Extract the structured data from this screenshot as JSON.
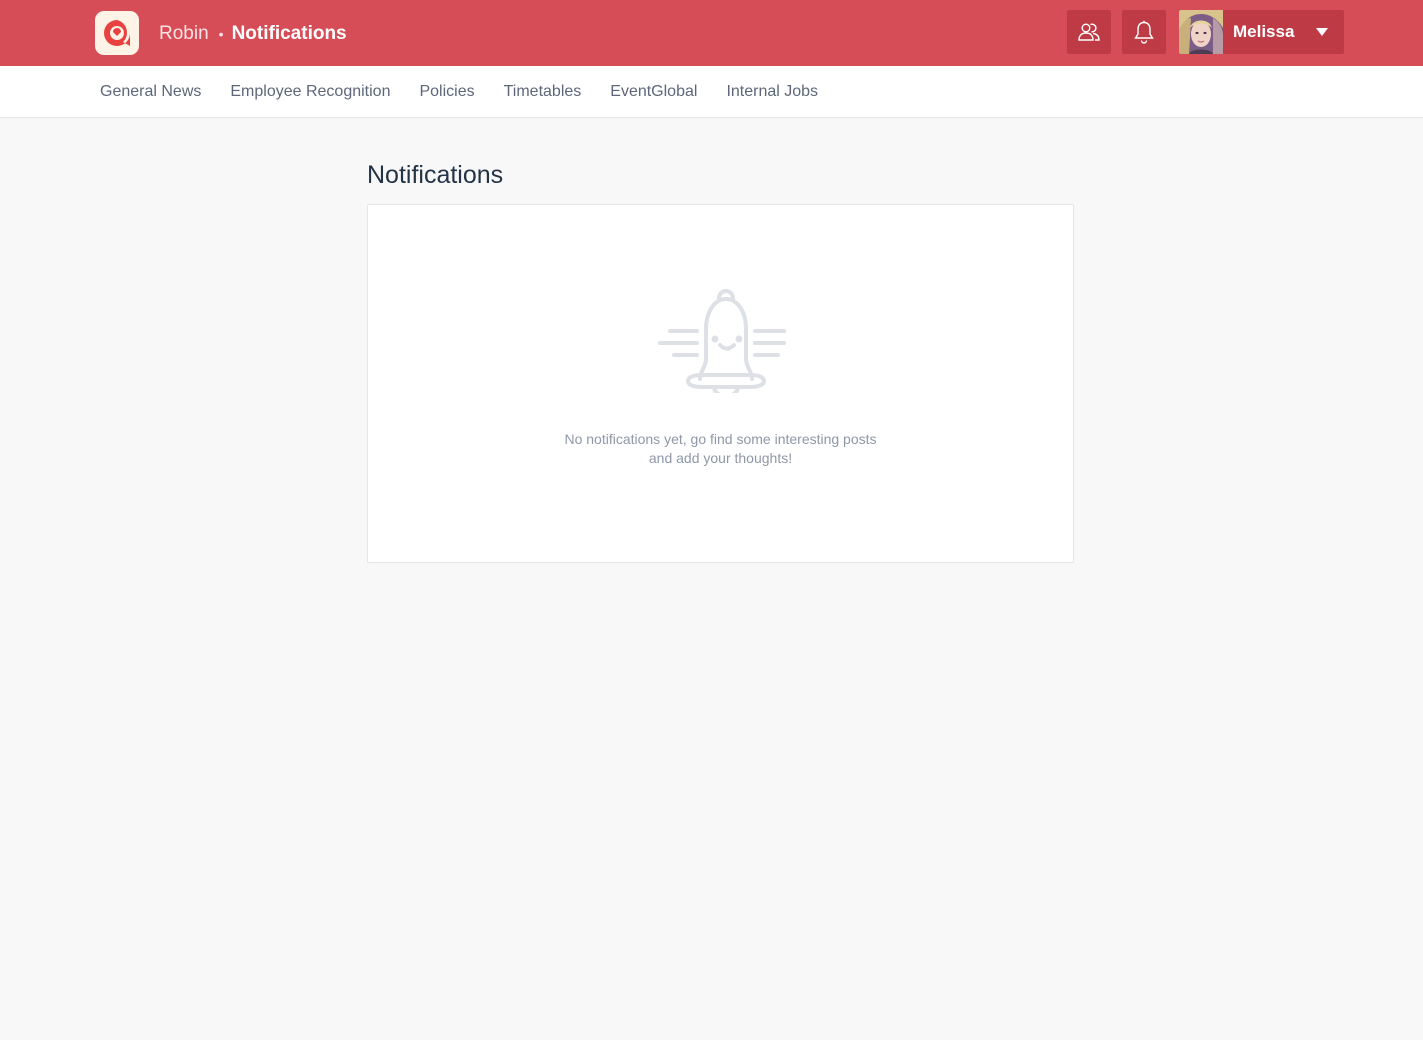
{
  "header": {
    "app_name": "Robin",
    "separator": "•",
    "current_page": "Notifications",
    "brand_color": "#d64d57",
    "user": {
      "name": "Melissa"
    },
    "icons": {
      "people": "people-icon",
      "notifications": "bell-icon",
      "dropdown": "caret-down-icon"
    }
  },
  "subnav": {
    "items": [
      {
        "label": "General News"
      },
      {
        "label": "Employee Recognition"
      },
      {
        "label": "Policies"
      },
      {
        "label": "Timetables"
      },
      {
        "label": "EventGlobal"
      },
      {
        "label": "Internal Jobs"
      }
    ]
  },
  "main": {
    "title": "Notifications",
    "empty_state": {
      "icon": "smiling-bell-icon",
      "line1": "No notifications yet, go find some interesting posts",
      "line2": "and add your thoughts!"
    }
  }
}
